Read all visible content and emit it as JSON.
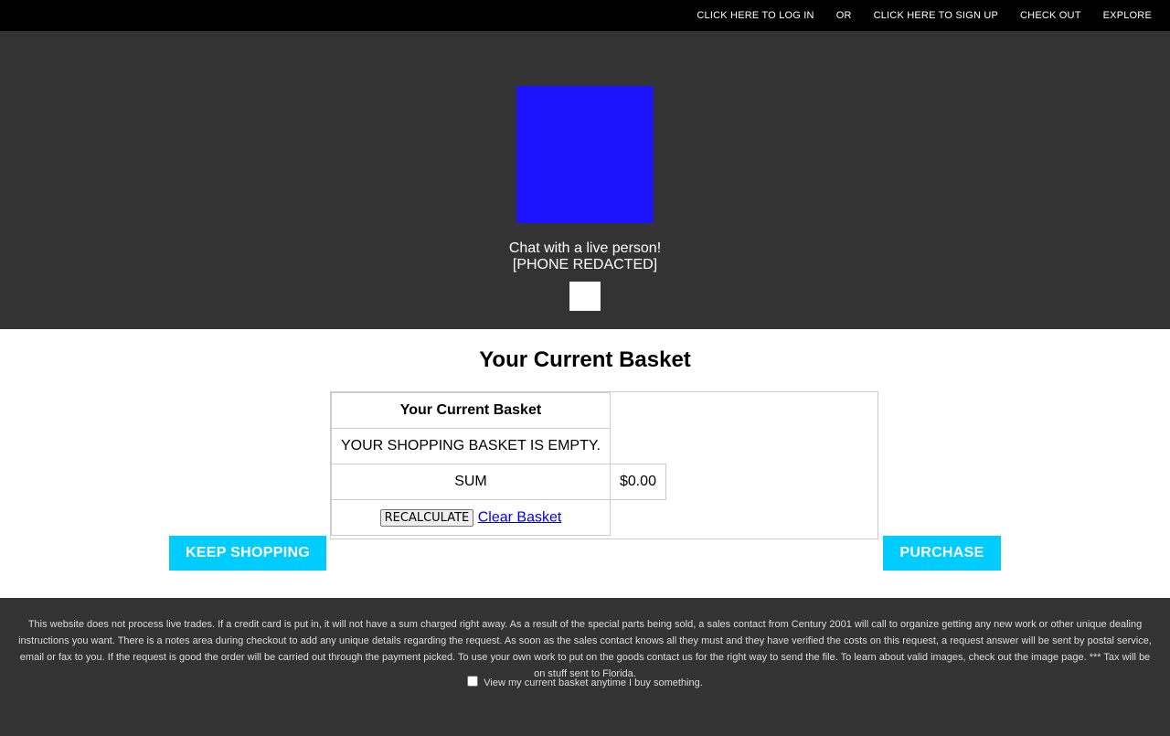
{
  "topnav": {
    "login": "CLICK HERE TO LOG IN",
    "or": "OR",
    "signup": "CLICK HERE TO SIGN UP",
    "checkout": "CHECK OUT",
    "explore": "EXPLORE"
  },
  "hero": {
    "chat_line": "Chat with a live person!",
    "phone": "[PHONE REDACTED]",
    "logo_color": "#1d14ff"
  },
  "main": {
    "title": "Your Current Basket",
    "table": {
      "header": "Your Current Basket",
      "empty_message": "YOUR SHOPPING BASKET IS EMPTY.",
      "sum_label": "SUM",
      "sum_value": "$0.00",
      "recalculate_label": "RECALCULATE",
      "clear_label": "Clear Basket"
    },
    "keep_shopping_label": "KEEP SHOPPING",
    "purchase_label": "PURCHASE",
    "accent_color": "#00ccff"
  },
  "footer": {
    "notice": "This website does not process live trades. If a credit card is put in, it will not have a sum charged right away. As a result of the special parts being sold, a sales contact from Century 2001 will call to organize getting any new work or other unique dealing instructions you want. There is a notes area during checkout to add any unique details regarding the request. As soon as the sales contact knows all they must and they have verified the costs on this request, a request answer will be sent by postal service, email or fax to you. If the request is good the order will be carried out through the payment picked. To use your own work to put on the goods contact us for the right way to send the file. To learn about valid images, check out the image page. *** Tax will be on stuff sent to Florida.",
    "checkbox_label": "View my current basket anytime I buy something.",
    "checkbox_checked": false
  }
}
